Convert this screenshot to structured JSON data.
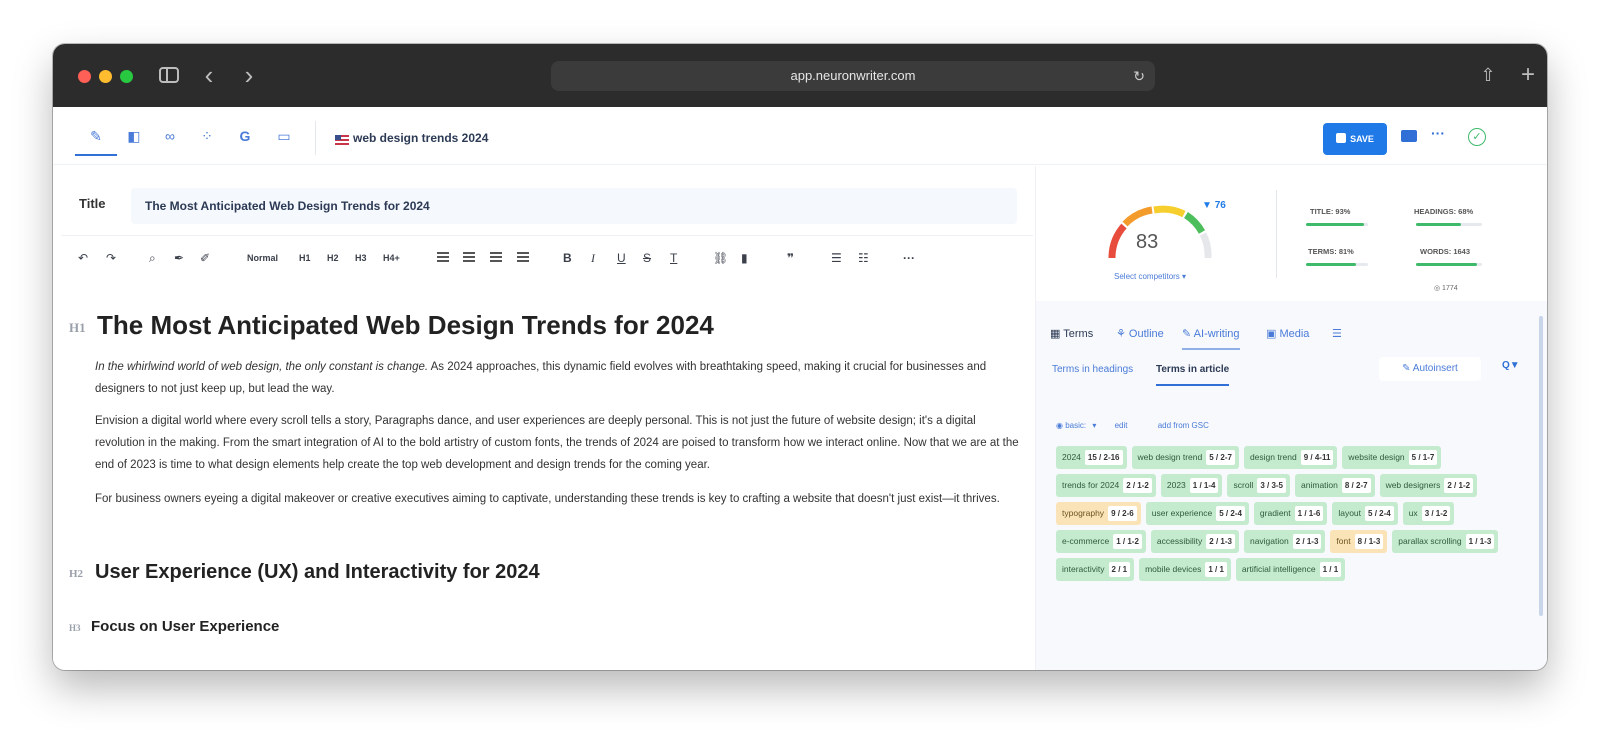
{
  "browser": {
    "url": "app.neuronwriter.com"
  },
  "toolbar": {
    "project_title": "web design trends 2024",
    "save_label": "SAVE",
    "tool_icons": [
      "pen-icon",
      "analytics-icon",
      "link-icon",
      "graph-icon",
      "google-icon",
      "chat-icon"
    ]
  },
  "editor": {
    "title_label": "Title",
    "title_value": "The Most Anticipated Web Design Trends for 2024",
    "format": {
      "normal": "Normal",
      "h1": "H1",
      "h2": "H2",
      "h3": "H3",
      "h4": "H4+",
      "bold": "B",
      "italic": "I",
      "underline": "U",
      "strike": "S",
      "clear": "T",
      "quote": "❞",
      "more": "···"
    },
    "tags": {
      "h1": "H1",
      "h2": "H2",
      "h3": "H3"
    },
    "h1": "The Most Anticipated Web Design Trends for 2024",
    "p1_italic": "In the whirlwind world of web design, the only constant is change.",
    "p1_rest": " As 2024 approaches, this dynamic field evolves with breathtaking speed, making it crucial for businesses and designers to not just keep up, but lead the way.",
    "p2": "Envision a digital world where every scroll tells a story, Paragraphs dance, and user experiences are deeply personal. This is not just the future of website design; it's a digital revolution in the making. From the smart integration of AI to the bold artistry of custom fonts, the trends of 2024 are poised to transform how we interact online. Now that we are at the end of 2023 is time to what design elements help create the top web development and design trends for the coming year.",
    "p3": "For business owners eyeing a digital makeover or creative executives aiming to captivate, understanding these trends is key to crafting a website that doesn't just exist—it thrives.",
    "h2": "User Experience (UX) and Interactivity for 2024",
    "h3": "Focus on User Experience"
  },
  "score": {
    "value": "83",
    "target": "76",
    "select_competitors": "Select competitors ▾",
    "metrics": [
      {
        "label": "TITLE: 93%",
        "fill": 0.93
      },
      {
        "label": "HEADINGS: 68%",
        "fill": 0.68
      },
      {
        "label": "TERMS: 81%",
        "fill": 0.81
      },
      {
        "label": "WORDS: 1643",
        "fill": 0.93
      }
    ],
    "words_target": "◎ 1774"
  },
  "panel": {
    "tabs": [
      "Terms",
      "Outline",
      "AI-writing",
      "Media"
    ],
    "subtabs": [
      "Terms in headings",
      "Terms in article"
    ],
    "autoinsert": "Autoinsert",
    "filter": "Q▼",
    "basic": "◉ basic:",
    "basic_arrow": "▾",
    "edit": "edit",
    "add_from_gsc": "add from GSC"
  },
  "terms": [
    {
      "term": "2024",
      "count": "15 / 2-16",
      "status": "green"
    },
    {
      "term": "web design trend",
      "count": "5 / 2-7",
      "status": "green"
    },
    {
      "term": "design trend",
      "count": "9 / 4-11",
      "status": "green"
    },
    {
      "term": "website design",
      "count": "5 / 1-7",
      "status": "green"
    },
    {
      "term": "trends for 2024",
      "count": "2 / 1-2",
      "status": "green"
    },
    {
      "term": "2023",
      "count": "1 / 1-4",
      "status": "green"
    },
    {
      "term": "scroll",
      "count": "3 / 3-5",
      "status": "green"
    },
    {
      "term": "animation",
      "count": "8 / 2-7",
      "status": "green"
    },
    {
      "term": "web designers",
      "count": "2 / 1-2",
      "status": "green"
    },
    {
      "term": "typography",
      "count": "9 / 2-6",
      "status": "yellow"
    },
    {
      "term": "user experience",
      "count": "5 / 2-4",
      "status": "green"
    },
    {
      "term": "gradient",
      "count": "1 / 1-6",
      "status": "green"
    },
    {
      "term": "layout",
      "count": "5 / 2-4",
      "status": "green"
    },
    {
      "term": "ux",
      "count": "3 / 1-2",
      "status": "green"
    },
    {
      "term": "e-commerce",
      "count": "1 / 1-2",
      "status": "green"
    },
    {
      "term": "accessibility",
      "count": "2 / 1-3",
      "status": "green"
    },
    {
      "term": "navigation",
      "count": "2 / 1-3",
      "status": "green"
    },
    {
      "term": "font",
      "count": "8 / 1-3",
      "status": "yellow"
    },
    {
      "term": "parallax scrolling",
      "count": "1 / 1-3",
      "status": "green"
    },
    {
      "term": "interactivity",
      "count": "2 / 1",
      "status": "green"
    },
    {
      "term": "mobile devices",
      "count": "1 / 1",
      "status": "green"
    },
    {
      "term": "artificial intelligence",
      "count": "1 / 1",
      "status": "green"
    }
  ],
  "colors": {
    "accent": "#1f7ae8",
    "chip_green": "#c4ebce",
    "chip_yellow": "#fbe3b8",
    "score_good": "#3fba6b"
  }
}
